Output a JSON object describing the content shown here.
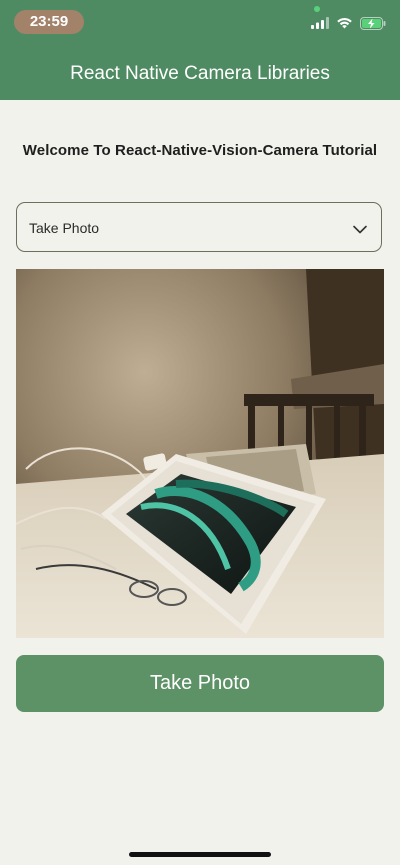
{
  "status_bar": {
    "time": "23:59"
  },
  "header": {
    "title": "React Native Camera Libraries"
  },
  "welcome_text": "Welcome To React-Native-Vision-Camera Tutorial",
  "dropdown": {
    "selected": "Take Photo"
  },
  "primary_button": {
    "label": "Take Photo"
  },
  "colors": {
    "header_green": "#4f8b62",
    "button_green": "#5d9166",
    "background": "#f2f2ec",
    "time_pill": "#a3826a"
  },
  "icons": [
    "signal-icon",
    "wifi-icon",
    "battery-charging-icon",
    "chevron-down-icon"
  ]
}
